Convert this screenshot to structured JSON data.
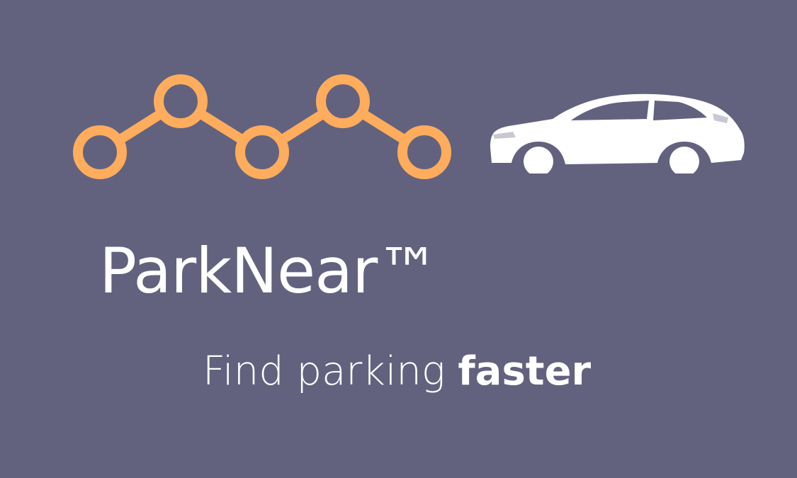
{
  "colors": {
    "background": "#62627f",
    "accent": "#ffad5c",
    "text": "#ffffff"
  },
  "logo": {
    "icon": "connected-nodes-icon",
    "node_count": 5
  },
  "car_image": {
    "icon": "hatchback-car-icon"
  },
  "brand": {
    "name": "ParkNear™"
  },
  "tagline": {
    "prefix": "Find parking ",
    "emphasis": "faster"
  }
}
